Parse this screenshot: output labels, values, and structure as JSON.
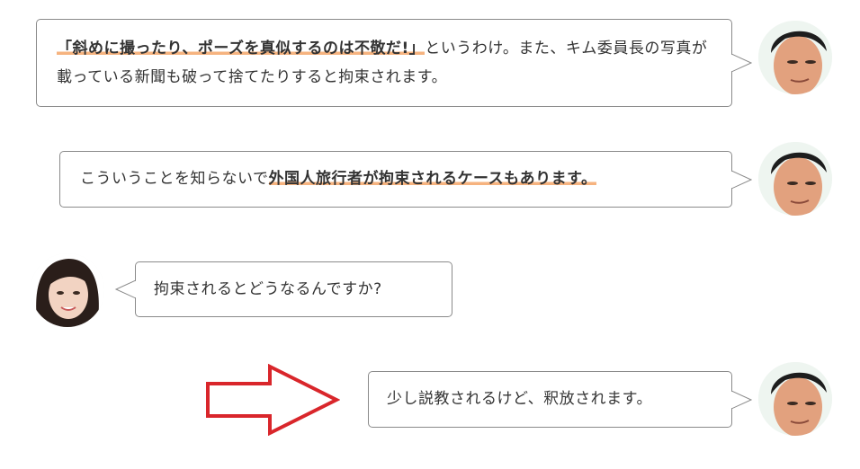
{
  "messages": [
    {
      "speaker": "man",
      "side": "right",
      "highlight": "「斜めに撮ったり、ポーズを真似するのは不敬だ!」",
      "text": "というわけ。また、キム委員長の写真が載っている新聞も破って捨てたりすると拘束されます。"
    },
    {
      "speaker": "man",
      "side": "right",
      "text": "こういうことを知らないで",
      "highlight": "外国人旅行者が拘束されるケースもあります。"
    },
    {
      "speaker": "woman",
      "side": "left",
      "text": "拘束されるとどうなるんですか?"
    },
    {
      "speaker": "man",
      "side": "right",
      "text": "少し説教されるけど、釈放されます。"
    }
  ],
  "colors": {
    "highlight_underline": "#f6b37f",
    "bubble_border": "#8a8a8a",
    "arrow": "#d9262b"
  },
  "icons": [
    "man-avatar",
    "woman-avatar",
    "right-arrow-icon"
  ]
}
